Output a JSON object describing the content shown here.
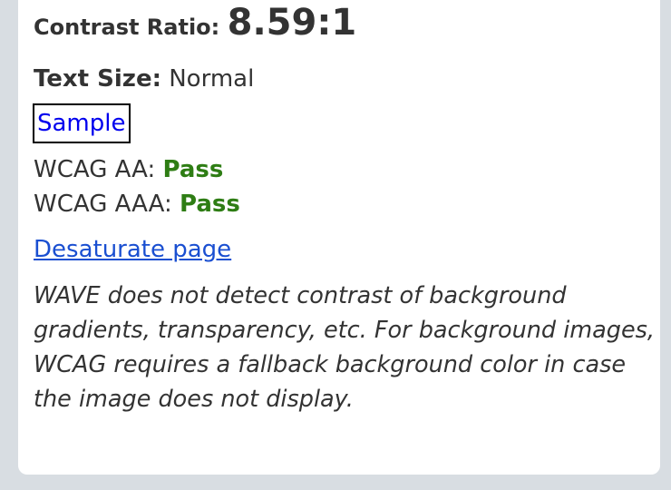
{
  "contrast": {
    "ratio_label": "Contrast Ratio:",
    "ratio_value": "8.59:1"
  },
  "text_size": {
    "label": "Text Size:",
    "value": "Normal"
  },
  "sample": {
    "label": "Sample",
    "foreground_color": "#0000ee",
    "background_color": "#ffffff"
  },
  "wcag": {
    "aa_label": "WCAG AA:",
    "aa_result": "Pass",
    "aaa_label": "WCAG AAA:",
    "aaa_result": "Pass",
    "pass_color": "#2e7d14"
  },
  "desaturate_link": "Desaturate page",
  "note_text": "WAVE does not detect contrast of background gradients, transparency, etc. For background images, WCAG requires a fallback background color in case the image does not display."
}
